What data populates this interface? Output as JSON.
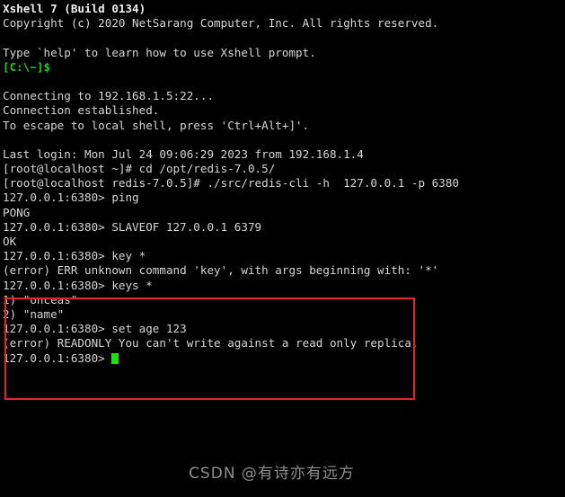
{
  "terminal": {
    "app_title": "Xshell 7 (Build 0134)",
    "colors": {
      "background": "#000000",
      "foreground": "#d6d6d6",
      "prompt_green": "#17d117",
      "cursor_green": "#19e019",
      "highlight_red": "#e8202a",
      "watermark_gray": "#8d8d8d"
    },
    "lines": [
      {
        "id": "banner-title",
        "text": "Xshell 7 (Build 0134)",
        "style": "bold"
      },
      {
        "id": "banner-copyright",
        "text": "Copyright (c) 2020 NetSarang Computer, Inc. All rights reserved.",
        "style": "normal"
      },
      {
        "id": "blank-1",
        "text": "",
        "style": "blank"
      },
      {
        "id": "banner-help",
        "text": "Type `help' to learn how to use Xshell prompt.",
        "style": "normal"
      },
      {
        "id": "local-prompt",
        "text": "[C:\\~]$",
        "style": "green"
      },
      {
        "id": "blank-2",
        "text": "",
        "style": "blank"
      },
      {
        "id": "connecting",
        "text": "Connecting to 192.168.1.5:22...",
        "style": "normal"
      },
      {
        "id": "connection-established",
        "text": "Connection established.",
        "style": "normal"
      },
      {
        "id": "escape-hint",
        "text": "To escape to local shell, press 'Ctrl+Alt+]'.",
        "style": "normal"
      },
      {
        "id": "blank-3",
        "text": "",
        "style": "blank"
      },
      {
        "id": "last-login",
        "text": "Last login: Mon Jul 24 09:06:29 2023 from 192.168.1.4",
        "style": "normal"
      },
      {
        "id": "cmd-cd",
        "text": "[root@localhost ~]# cd /opt/redis-7.0.5/",
        "style": "normal"
      },
      {
        "id": "cmd-redis-cli",
        "text": "[root@localhost redis-7.0.5]# ./src/redis-cli -h  127.0.0.1 -p 6380",
        "style": "normal"
      },
      {
        "id": "cmd-ping",
        "text": "127.0.0.1:6380> ping",
        "style": "normal"
      },
      {
        "id": "out-pong",
        "text": "PONG",
        "style": "normal"
      },
      {
        "id": "cmd-slaveof",
        "text": "127.0.0.1:6380> SLAVEOF 127.0.0.1 6379",
        "style": "normal"
      },
      {
        "id": "out-ok",
        "text": "OK",
        "style": "normal"
      },
      {
        "id": "cmd-key-star",
        "text": "127.0.0.1:6380> key *",
        "style": "normal"
      },
      {
        "id": "out-err-unknown",
        "text": "(error) ERR unknown command 'key', with args beginning with: '*'",
        "style": "normal"
      },
      {
        "id": "cmd-keys-star",
        "text": "127.0.0.1:6380> keys *",
        "style": "normal"
      },
      {
        "id": "out-key-1",
        "text": "1) \"onceas\"",
        "style": "normal"
      },
      {
        "id": "out-key-2",
        "text": "2) \"name\"",
        "style": "normal"
      },
      {
        "id": "cmd-set-age",
        "text": "127.0.0.1:6380> set age 123",
        "style": "normal"
      },
      {
        "id": "out-err-readonly",
        "text": "(error) READONLY You can't write against a read only replica.",
        "style": "normal"
      },
      {
        "id": "active-prompt",
        "text": "127.0.0.1:6380> ",
        "style": "cursor"
      }
    ]
  },
  "annotation": {
    "name": "highlight-rectangle",
    "color": "#e8202a"
  },
  "watermark": {
    "text": "CSDN @有诗亦有远方"
  }
}
